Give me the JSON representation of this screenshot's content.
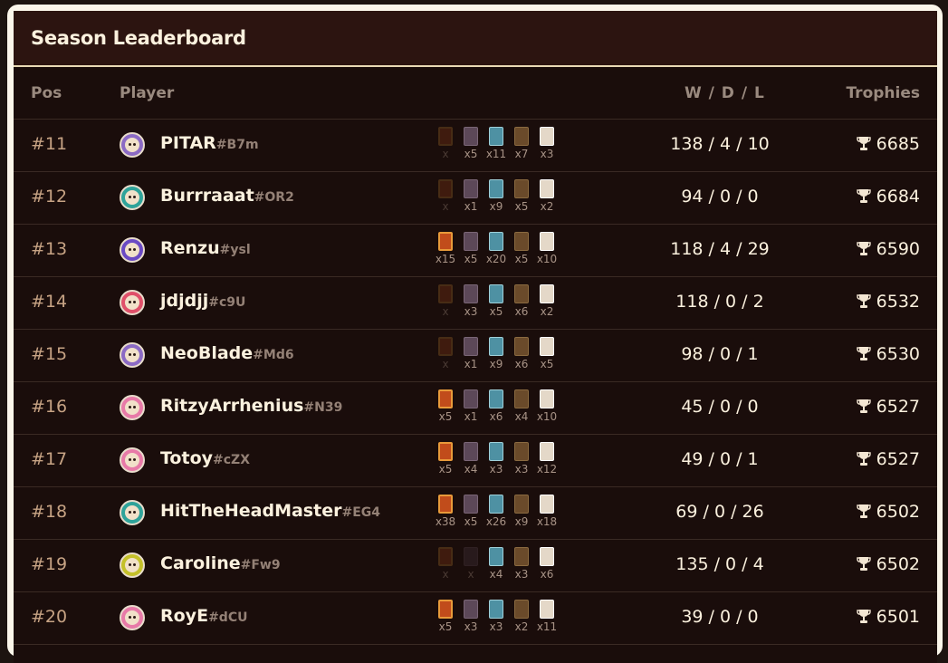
{
  "title": "Season Leaderboard",
  "headers": {
    "pos": "Pos",
    "player": "Player",
    "wdl": "W / D / L",
    "trophies": "Trophies"
  },
  "rows": [
    {
      "pos": "#11",
      "name": "PITAR",
      "tag": "#B7m",
      "avatar_color": "#8b6ac4",
      "cards": [
        "x",
        "x5",
        "x11",
        "x7",
        "x3"
      ],
      "wdl": "138 / 4 / 10",
      "trophies": "6685"
    },
    {
      "pos": "#12",
      "name": "Burrraaat",
      "tag": "#OR2",
      "avatar_color": "#2fa39a",
      "cards": [
        "x",
        "x1",
        "x9",
        "x5",
        "x2"
      ],
      "wdl": "94 / 0 / 0",
      "trophies": "6684"
    },
    {
      "pos": "#13",
      "name": "Renzu",
      "tag": "#ysl",
      "avatar_color": "#6a4ac4",
      "cards": [
        "x15",
        "x5",
        "x20",
        "x5",
        "x10"
      ],
      "wdl": "118 / 4 / 29",
      "trophies": "6590"
    },
    {
      "pos": "#14",
      "name": "jdjdjj",
      "tag": "#c9U",
      "avatar_color": "#e0506a",
      "cards": [
        "x",
        "x3",
        "x5",
        "x6",
        "x2"
      ],
      "wdl": "118 / 0 / 2",
      "trophies": "6532"
    },
    {
      "pos": "#15",
      "name": "NeoBlade",
      "tag": "#Md6",
      "avatar_color": "#8b6ac4",
      "cards": [
        "x",
        "x1",
        "x9",
        "x6",
        "x5"
      ],
      "wdl": "98 / 0 / 1",
      "trophies": "6530"
    },
    {
      "pos": "#16",
      "name": "RitzyArrhenius",
      "tag": "#N39",
      "avatar_color": "#e87aa8",
      "cards": [
        "x5",
        "x1",
        "x6",
        "x4",
        "x10"
      ],
      "wdl": "45 / 0 / 0",
      "trophies": "6527"
    },
    {
      "pos": "#17",
      "name": "Totoy",
      "tag": "#cZX",
      "avatar_color": "#e87aa8",
      "cards": [
        "x5",
        "x4",
        "x3",
        "x3",
        "x12"
      ],
      "wdl": "49 / 0 / 1",
      "trophies": "6527"
    },
    {
      "pos": "#18",
      "name": "HitTheHeadMaster",
      "tag": "#EG4",
      "avatar_color": "#2fa39a",
      "cards": [
        "x38",
        "x5",
        "x26",
        "x9",
        "x18"
      ],
      "wdl": "69 / 0 / 26",
      "trophies": "6502"
    },
    {
      "pos": "#19",
      "name": "Caroline",
      "tag": "#Fw9",
      "avatar_color": "#c4c02a",
      "cards": [
        "x",
        "x",
        "x4",
        "x3",
        "x6"
      ],
      "wdl": "135 / 0 / 4",
      "trophies": "6502"
    },
    {
      "pos": "#20",
      "name": "RoyE",
      "tag": "#dCU",
      "avatar_color": "#e87aa8",
      "cards": [
        "x5",
        "x3",
        "x3",
        "x2",
        "x11"
      ],
      "wdl": "39 / 0 / 0",
      "trophies": "6501"
    }
  ],
  "icons": {
    "trophy": "trophy-icon",
    "avatar": "avatar-icon"
  },
  "colors": {
    "frame": "#fbf6ea",
    "panel": "#1a0d0b",
    "header": "#2c1410",
    "pos": "#c7a384",
    "name": "#fbf1de",
    "tag": "#948176"
  }
}
